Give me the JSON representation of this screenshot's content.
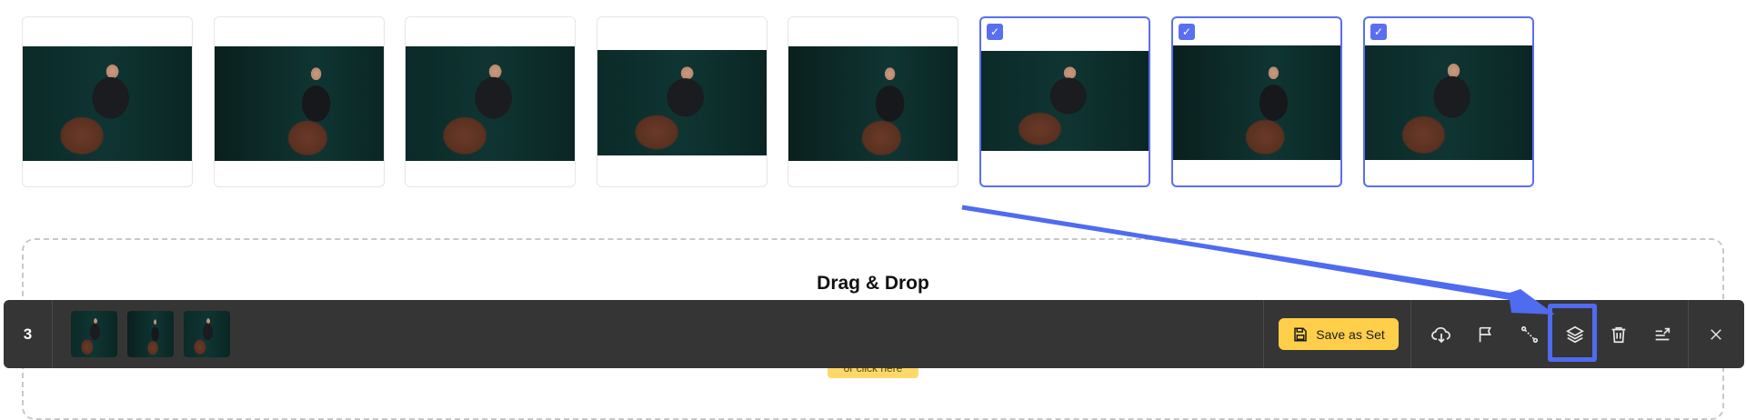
{
  "gallery": {
    "photos": [
      {
        "alt": "photo-1",
        "selected": false
      },
      {
        "alt": "photo-2",
        "selected": false
      },
      {
        "alt": "photo-3",
        "selected": false
      },
      {
        "alt": "photo-4",
        "selected": false
      },
      {
        "alt": "photo-5",
        "selected": false
      },
      {
        "alt": "photo-6",
        "selected": true
      },
      {
        "alt": "photo-7",
        "selected": true
      },
      {
        "alt": "photo-8",
        "selected": true
      }
    ],
    "check_glyph": "✓"
  },
  "dropzone": {
    "title": "Drag & Drop",
    "click_label": "or click here"
  },
  "selection_bar": {
    "count": "3",
    "save_label": "Save as Set",
    "icons": [
      "download-cloud-icon",
      "flag-icon",
      "connect-icon",
      "layers-icon",
      "trash-icon",
      "sort-export-icon",
      "close-icon"
    ]
  },
  "colors": {
    "accent": "#5a6ff0",
    "bar": "#353535",
    "save": "#ffcf4a"
  }
}
